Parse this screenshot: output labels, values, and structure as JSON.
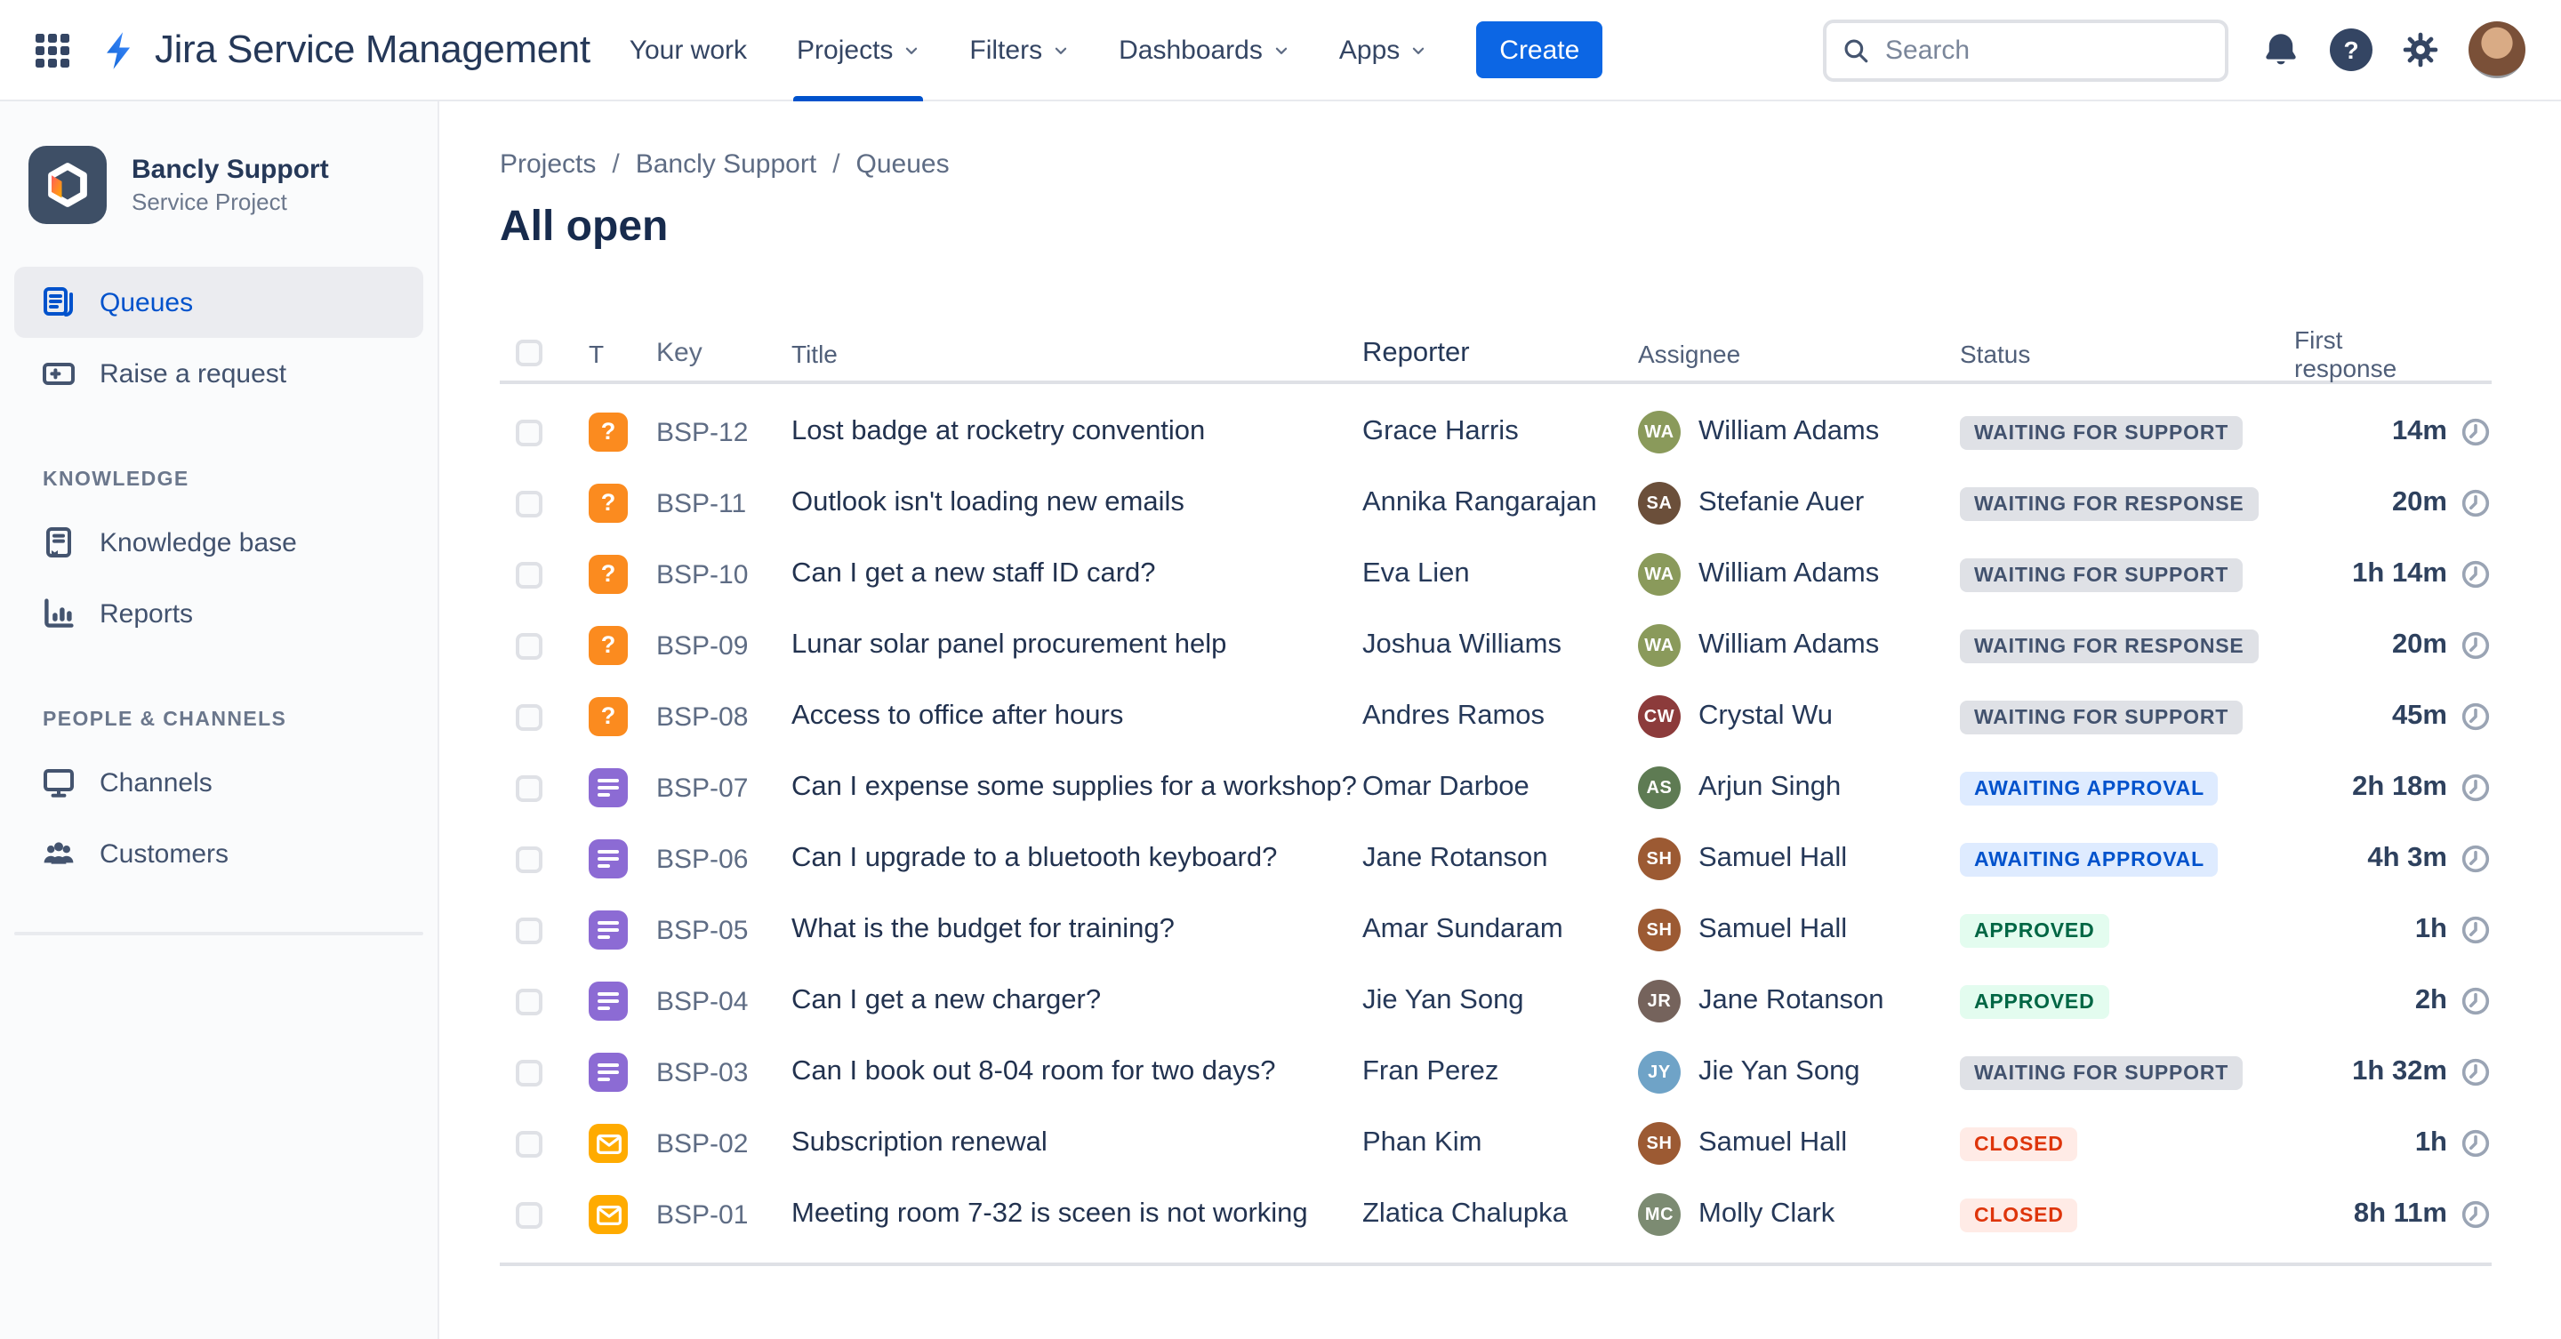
{
  "header": {
    "product_name": "Jira Service Management",
    "nav": [
      {
        "label": "Your work",
        "has_menu": false,
        "active": false
      },
      {
        "label": "Projects",
        "has_menu": true,
        "active": true
      },
      {
        "label": "Filters",
        "has_menu": true,
        "active": false
      },
      {
        "label": "Dashboards",
        "has_menu": true,
        "active": false
      },
      {
        "label": "Apps",
        "has_menu": true,
        "active": false
      }
    ],
    "create_label": "Create",
    "search_placeholder": "Search"
  },
  "sidebar": {
    "project": {
      "name": "Bancly Support",
      "type": "Service Project"
    },
    "items": [
      {
        "label": "Queues",
        "icon": "queues-icon",
        "active": true
      },
      {
        "label": "Raise a request",
        "icon": "raise-request-icon",
        "active": false
      }
    ],
    "sections": [
      {
        "title": "KNOWLEDGE",
        "items": [
          {
            "label": "Knowledge base",
            "icon": "book-icon"
          },
          {
            "label": "Reports",
            "icon": "bar-chart-icon"
          }
        ]
      },
      {
        "title": "PEOPLE & CHANNELS",
        "items": [
          {
            "label": "Channels",
            "icon": "monitor-icon"
          },
          {
            "label": "Customers",
            "icon": "people-icon"
          }
        ]
      }
    ]
  },
  "main": {
    "breadcrumb": [
      "Projects",
      "Bancly Support",
      "Queues"
    ],
    "page_title": "All open",
    "table": {
      "columns": {
        "type": "T",
        "key": "Key",
        "title": "Title",
        "reporter": "Reporter",
        "assignee": "Assignee",
        "status": "Status",
        "first_response": "First response"
      },
      "rows": [
        {
          "type": "question",
          "key": "BSP-12",
          "title": "Lost badge at rocketry convention",
          "reporter": "Grace Harris",
          "assignee": "William Adams",
          "status": "WAITING FOR SUPPORT",
          "status_kind": "gray",
          "first_response": "14m"
        },
        {
          "type": "question",
          "key": "BSP-11",
          "title": "Outlook isn't loading new emails",
          "reporter": "Annika Rangarajan",
          "assignee": "Stefanie Auer",
          "status": "WAITING FOR RESPONSE",
          "status_kind": "gray",
          "first_response": "20m"
        },
        {
          "type": "question",
          "key": "BSP-10",
          "title": "Can I get a new staff ID card?",
          "reporter": "Eva Lien",
          "assignee": "William Adams",
          "status": "WAITING FOR SUPPORT",
          "status_kind": "gray",
          "first_response": "1h 14m"
        },
        {
          "type": "question",
          "key": "BSP-09",
          "title": "Lunar solar panel procurement help",
          "reporter": "Joshua Williams",
          "assignee": "William Adams",
          "status": "WAITING FOR RESPONSE",
          "status_kind": "gray",
          "first_response": "20m"
        },
        {
          "type": "question",
          "key": "BSP-08",
          "title": "Access to office after hours",
          "reporter": "Andres Ramos",
          "assignee": "Crystal Wu",
          "status": "WAITING FOR SUPPORT",
          "status_kind": "gray",
          "first_response": "45m"
        },
        {
          "type": "request",
          "key": "BSP-07",
          "title": "Can I expense some supplies for a workshop?",
          "reporter": "Omar Darboe",
          "assignee": "Arjun Singh",
          "status": "AWAITING APPROVAL",
          "status_kind": "blue",
          "first_response": "2h 18m"
        },
        {
          "type": "request",
          "key": "BSP-06",
          "title": "Can I upgrade to a bluetooth keyboard?",
          "reporter": "Jane Rotanson",
          "assignee": "Samuel Hall",
          "status": "AWAITING APPROVAL",
          "status_kind": "blue",
          "first_response": "4h 3m"
        },
        {
          "type": "request",
          "key": "BSP-05",
          "title": "What is the budget for training?",
          "reporter": "Amar Sundaram",
          "assignee": "Samuel Hall",
          "status": "APPROVED",
          "status_kind": "green",
          "first_response": "1h"
        },
        {
          "type": "request",
          "key": "BSP-04",
          "title": "Can I get a new charger?",
          "reporter": "Jie Yan Song",
          "assignee": "Jane Rotanson",
          "status": "APPROVED",
          "status_kind": "green",
          "first_response": "2h"
        },
        {
          "type": "request",
          "key": "BSP-03",
          "title": "Can I book out 8-04 room for two days?",
          "reporter": "Fran Perez",
          "assignee": "Jie Yan Song",
          "status": "WAITING FOR SUPPORT",
          "status_kind": "gray",
          "first_response": "1h 32m"
        },
        {
          "type": "email",
          "key": "BSP-02",
          "title": "Subscription renewal",
          "reporter": "Phan Kim",
          "assignee": "Samuel Hall",
          "status": "CLOSED",
          "status_kind": "red",
          "first_response": "1h"
        },
        {
          "type": "email",
          "key": "BSP-01",
          "title": "Meeting room 7-32 is sceen is not working",
          "reporter": "Zlatica Chalupka",
          "assignee": "Molly Clark",
          "status": "CLOSED",
          "status_kind": "red",
          "first_response": "8h 11m"
        }
      ]
    }
  },
  "colors": {
    "accent_blue": "#0052CC",
    "create_button": "#0C66E4",
    "status": {
      "gray_bg": "#DFE1E6",
      "gray_text": "#42526E",
      "blue_bg": "#DEEBFF",
      "blue_text": "#0052CC",
      "green_bg": "#E3FCEF",
      "green_text": "#006644",
      "red_bg": "#FFEBE6",
      "red_text": "#DE350B"
    },
    "type_icons": {
      "question": "#FB8B1F",
      "request": "#8C6BD4",
      "email": "#FFAB00"
    }
  }
}
